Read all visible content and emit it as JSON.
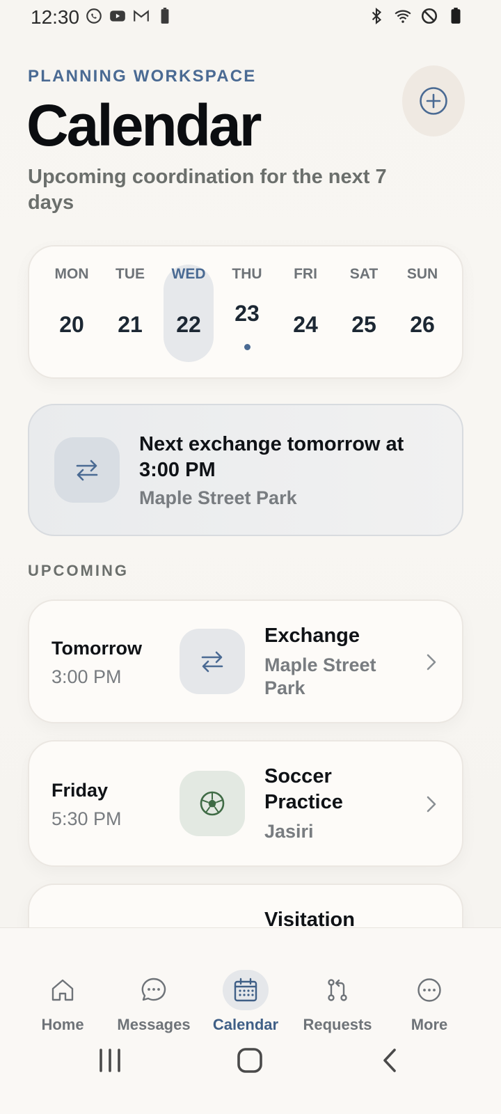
{
  "status_bar": {
    "time": "12:30",
    "left_icons": [
      "whatsapp-icon",
      "youtube-icon",
      "gmail-icon",
      "battery-saver-icon"
    ],
    "right_icons": [
      "bluetooth-icon",
      "wifi-icon",
      "do-not-disturb-icon",
      "battery-icon"
    ]
  },
  "header": {
    "eyebrow": "PLANNING WORKSPACE",
    "title": "Calendar",
    "subtitle": "Upcoming coordination for the next 7 days",
    "add_icon": "plus-circle-icon"
  },
  "week": {
    "selected_index": 2,
    "event_index": 3,
    "days": [
      {
        "name": "MON",
        "num": "20"
      },
      {
        "name": "TUE",
        "num": "21"
      },
      {
        "name": "WED",
        "num": "22"
      },
      {
        "name": "THU",
        "num": "23"
      },
      {
        "name": "FRI",
        "num": "24"
      },
      {
        "name": "SAT",
        "num": "25"
      },
      {
        "name": "SUN",
        "num": "26"
      }
    ]
  },
  "banner": {
    "title": "Next exchange tomorrow at 3:00 PM",
    "subtitle": "Maple Street Park",
    "icon": "swap-arrows-icon"
  },
  "upcoming": {
    "label": "UPCOMING",
    "events": [
      {
        "day": "Tomorrow",
        "time": "3:00 PM",
        "title": "Exchange",
        "subtitle": "Maple Street Park",
        "icon": "swap-arrows-icon",
        "icon_bg": "#e5e7ea"
      },
      {
        "day": "Friday",
        "time": "5:30 PM",
        "title": "Soccer Practice",
        "subtitle": "Jasiri",
        "icon": "soccer-ball-icon",
        "icon_bg": "#e3e9e2"
      },
      {
        "title": "Visitation"
      }
    ]
  },
  "nav": {
    "active": "Calendar",
    "items": [
      {
        "label": "Home",
        "icon": "home-icon"
      },
      {
        "label": "Messages",
        "icon": "chat-bubble-icon"
      },
      {
        "label": "Calendar",
        "icon": "calendar-icon"
      },
      {
        "label": "Requests",
        "icon": "pull-request-icon"
      },
      {
        "label": "More",
        "icon": "more-dots-icon"
      }
    ]
  },
  "colors": {
    "accent": "#4a6a93",
    "title": "#0b0d10",
    "muted": "#787c80",
    "card": "#fdfbf8"
  }
}
